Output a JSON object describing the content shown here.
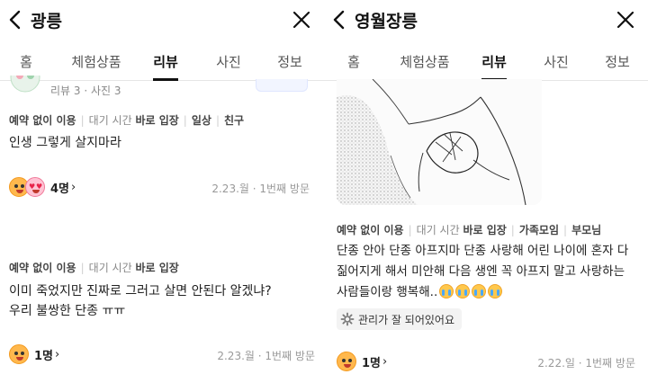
{
  "left": {
    "title": "광릉",
    "tabs": [
      "홈",
      "체험상품",
      "리뷰",
      "사진",
      "정보"
    ],
    "active_tab": "리뷰",
    "reviewer_meta": "리뷰 3 · 사진 3",
    "reviews": [
      {
        "tags": [
          {
            "prefix": "",
            "bold": "예약 없이 이용"
          },
          {
            "prefix": "대기 시간 ",
            "bold": "바로 입장"
          },
          {
            "prefix": "",
            "bold": "일상"
          },
          {
            "prefix": "",
            "bold": "친구"
          }
        ],
        "text": "인생 그렇게 살지마라",
        "reaction_count": "4명",
        "visit": "2.23.월 · 1번째 방문"
      },
      {
        "tags": [
          {
            "prefix": "",
            "bold": "예약 없이 이용"
          },
          {
            "prefix": "대기 시간 ",
            "bold": "바로 입장"
          }
        ],
        "text_lines": [
          "이미 죽었지만 진짜로 그러고 살면 안된다 알겠냐?",
          "우리 불쌍한 단종 ㅠㅠ"
        ],
        "reaction_count": "1명",
        "visit": "2.23.월 · 1번째 방문"
      }
    ]
  },
  "right": {
    "title": "영월장릉",
    "tabs": [
      "홈",
      "체험상품",
      "리뷰",
      "사진",
      "정보"
    ],
    "active_tab": "리뷰",
    "review": {
      "tags": [
        {
          "prefix": "",
          "bold": "예약 없이 이용"
        },
        {
          "prefix": "대기 시간 ",
          "bold": "바로 입장"
        },
        {
          "prefix": "",
          "bold": "가족모임"
        },
        {
          "prefix": "",
          "bold": "부모님"
        }
      ],
      "text_lines": [
        "단종 안아 단종 아프지마 단종 사랑해 어린 나이에 혼자 다",
        "짊어지게 해서 미안해 다음 생엔 꼭 아프지 말고 사랑하는",
        "사람들이랑 행복해.."
      ],
      "keyword_chip": "관리가 잘 되어있어요",
      "reaction_count": "1명",
      "visit": "2.22.일 · 1번째 방문"
    }
  },
  "icons": {
    "back": "chevron-left-icon",
    "close": "close-icon",
    "chip": "gear-icon",
    "reaction": "emoji-face-icon"
  },
  "colors": {
    "text": "#222222",
    "muted": "#888888",
    "active_tab_underline": "#111111",
    "chip_bg": "#f3f3f3"
  }
}
